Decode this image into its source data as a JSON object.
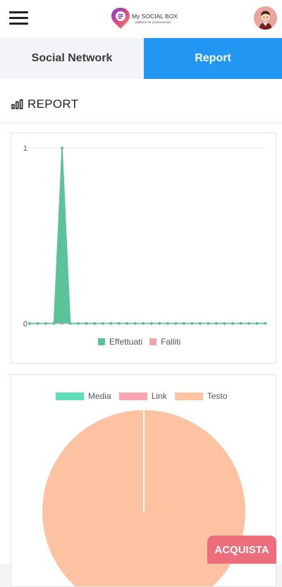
{
  "header": {
    "logo_name": "My SOCIAL BOX",
    "logo_tagline": "platform for professionals",
    "icons": {
      "menu": "hamburger-icon",
      "avatar": "user-avatar"
    }
  },
  "tabs": [
    {
      "label": "Social Network",
      "active": false
    },
    {
      "label": "Report",
      "active": true
    }
  ],
  "report": {
    "title": "REPORT",
    "icon": "bar-chart-icon"
  },
  "chart_data": [
    {
      "type": "line",
      "x_count": 30,
      "ylim": [
        0,
        1
      ],
      "yticks": [
        "0",
        "1"
      ],
      "grid": true,
      "legend_position": "bottom",
      "series": [
        {
          "name": "Effettuati",
          "color": "#5cc29a",
          "fill": true,
          "values": [
            0,
            0,
            0,
            0,
            1,
            0,
            0,
            0,
            0,
            0,
            0,
            0,
            0,
            0,
            0,
            0,
            0,
            0,
            0,
            0,
            0,
            0,
            0,
            0,
            0,
            0,
            0,
            0,
            0,
            0
          ]
        },
        {
          "name": "Falliti",
          "color": "#f2a0ab",
          "values": [
            0,
            0,
            0,
            0,
            0,
            0,
            0,
            0,
            0,
            0,
            0,
            0,
            0,
            0,
            0,
            0,
            0,
            0,
            0,
            0,
            0,
            0,
            0,
            0,
            0,
            0,
            0,
            0,
            0,
            0
          ]
        }
      ]
    },
    {
      "type": "pie",
      "legend_position": "top",
      "labels": [
        "Media",
        "Link",
        "Testo"
      ],
      "colors": [
        "#5fdfb6",
        "#ffa5b2",
        "#fcc2a1"
      ],
      "values": [
        0,
        0,
        1
      ]
    }
  ],
  "cta": {
    "label": "ACQUISTA",
    "color": "#ec6d7c"
  },
  "colors": {
    "accent": "#2196f3",
    "tab_inactive_bg": "#f3f4f7"
  }
}
